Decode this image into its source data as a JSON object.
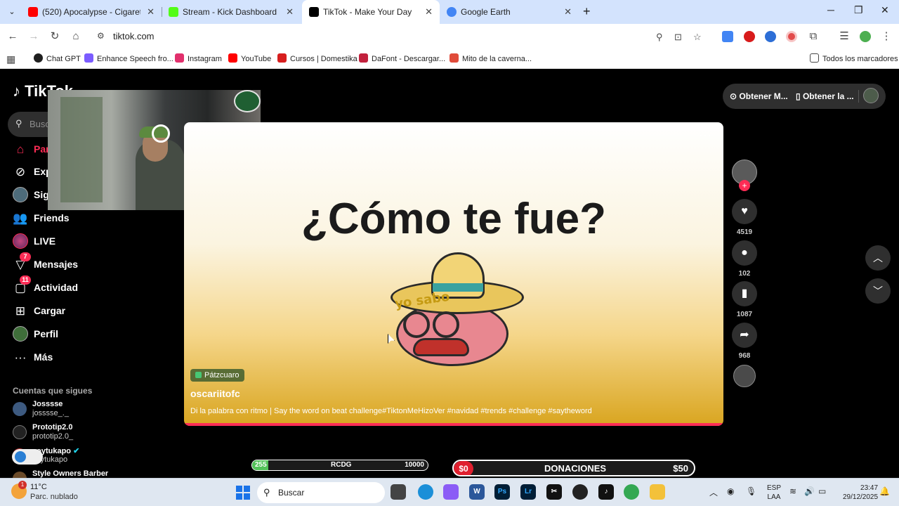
{
  "browser": {
    "tabs": [
      {
        "title": "(520) Apocalypse - Cigarettes A",
        "icon": "youtube-icon",
        "color": "#ff0000"
      },
      {
        "title": "Stream - Kick Dashboard",
        "icon": "kick-icon",
        "color": "#53fc18"
      },
      {
        "title": "TikTok - Make Your Day",
        "icon": "tiktok-icon",
        "color": "#000000",
        "active": true
      },
      {
        "title": "Google Earth",
        "icon": "google-earth-icon",
        "color": "#4285f4"
      }
    ],
    "url": "tiktok.com",
    "bookmarks": [
      {
        "label": "Chat GPT",
        "color": "#1f1f1f"
      },
      {
        "label": "Enhance Speech fro...",
        "color": "#7b5cff"
      },
      {
        "label": "Instagram",
        "color": "#e1306c"
      },
      {
        "label": "YouTube",
        "color": "#ff0000"
      },
      {
        "label": "Cursos | Domestika",
        "color": "#d71e1e"
      },
      {
        "label": "DaFont - Descargar...",
        "color": "#c2213d"
      },
      {
        "label": "Mito de la caverna...",
        "color": "#e04b3a"
      }
    ],
    "all_bookmarks_label": "Todos los marcadores"
  },
  "tiktok": {
    "logo_text": "TikTok",
    "search_placeholder": "Buscar",
    "nav": [
      {
        "label": "Para ti",
        "icon": "home-icon",
        "active": true
      },
      {
        "label": "Explorar",
        "icon": "compass-icon"
      },
      {
        "label": "Siguiendo",
        "icon": "following-icon"
      },
      {
        "label": "Friends",
        "icon": "friends-icon"
      },
      {
        "label": "LIVE",
        "icon": "live-icon"
      },
      {
        "label": "Mensajes",
        "icon": "messages-icon",
        "badge": "7"
      },
      {
        "label": "Actividad",
        "icon": "activity-icon",
        "badge": "11"
      },
      {
        "label": "Cargar",
        "icon": "upload-icon"
      },
      {
        "label": "Perfil",
        "icon": "profile-icon"
      },
      {
        "label": "Más",
        "icon": "more-icon"
      }
    ],
    "following_title": "Cuentas que sigues",
    "following": [
      {
        "name": "Josssse",
        "handle": "josssse_._"
      },
      {
        "name": "Prototip2.0",
        "handle": "prototip2.0_"
      },
      {
        "name": "soytukapo",
        "handle": "soytukapo",
        "verified": true
      },
      {
        "name": "Style Owners Barber",
        "handle": ""
      }
    ],
    "top_actions": {
      "get_coins": "Obtener M...",
      "get_app": "Obtener la ..."
    },
    "video": {
      "headline": "¿Cómo te fue?",
      "hat_text": "yo sabo",
      "location": "Pátzcuaro",
      "author": "oscariitofc",
      "caption": "Di la palabra con ritmo | Say the word on beat challenge#TiktonMeHizoVer #navidad #trends #challenge #saytheword"
    },
    "actions": {
      "likes": "4519",
      "comments": "102",
      "saves": "1087",
      "shares": "968"
    }
  },
  "overlays": {
    "goal": {
      "start": "255",
      "label": "RCDG",
      "end": "10000",
      "progress": 0.0255
    },
    "donations": {
      "current": "$0",
      "title": "DONACIONES",
      "goal": "$50"
    }
  },
  "taskbar": {
    "weather_badge": "1",
    "temperature": "11°C",
    "weather_desc": "Parc. nublado",
    "search_label": "Buscar",
    "lang_line1": "ESP",
    "lang_line2": "LAA",
    "time": "23:47",
    "date": "29/12/2025"
  }
}
